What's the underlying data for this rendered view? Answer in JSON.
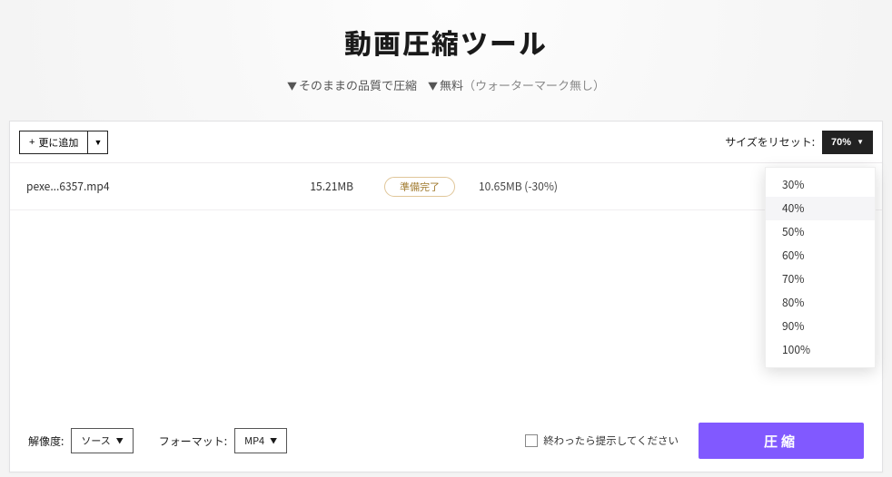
{
  "hero": {
    "title": "動画圧縮ツール",
    "sub1": "そのままの品質で圧縮",
    "sub2": "無料",
    "sub_paren": "（ウォーターマーク無し）"
  },
  "toolbar": {
    "add_label": "更に追加",
    "reset_label": "サイズをリセット:",
    "reset_value": "70%"
  },
  "file": {
    "name": "pexe...6357.mp4",
    "size": "15.21MB",
    "status": "準備完了",
    "estimate": "10.65MB (-30%)"
  },
  "dropdown": {
    "items": [
      "30%",
      "40%",
      "50%",
      "60%",
      "70%",
      "80%",
      "90%",
      "100%"
    ],
    "hover_index": 1
  },
  "footer": {
    "resolution_label": "解像度:",
    "resolution_value": "ソース",
    "format_label": "フォーマット:",
    "format_value": "MP4",
    "notify_label": "終わったら提示してください",
    "compress_label": "圧縮"
  }
}
